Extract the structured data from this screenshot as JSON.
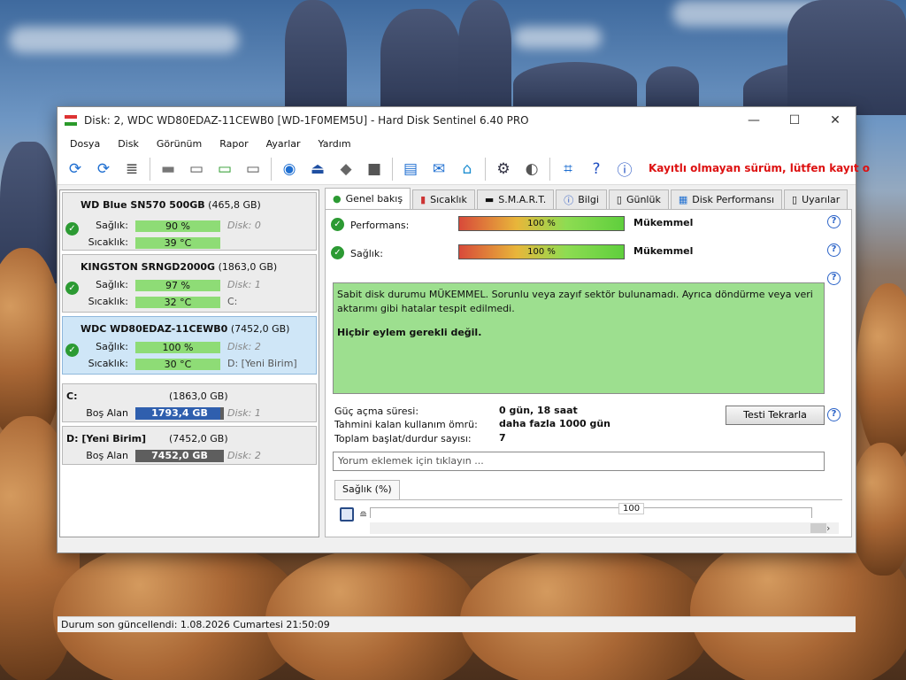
{
  "window": {
    "title": "Disk: 2, WDC WD80EDAZ-11CEWB0 [WD-1F0MEM5U]  -  Hard Disk Sentinel 6.40 PRO",
    "minimize": "—",
    "maximize": "☐",
    "close": "✕"
  },
  "menu": [
    "Dosya",
    "Disk",
    "Görünüm",
    "Rapor",
    "Ayarlar",
    "Yardım"
  ],
  "toolbar": {
    "unregistered_notice": "Kayıtlı olmayan sürüm, lütfen kayıt o"
  },
  "disks": [
    {
      "name": "WD Blue SN570 500GB",
      "size": "(465,8 GB)",
      "health_label": "Sağlık:",
      "health_value": "90 %",
      "temp_label": "Sıcaklık:",
      "temp_value": "39 °C",
      "disk_index": "Disk: 0",
      "partition": ""
    },
    {
      "name": "KINGSTON SRNGD2000G",
      "size": "(1863,0 GB)",
      "health_label": "Sağlık:",
      "health_value": "97 %",
      "temp_label": "Sıcaklık:",
      "temp_value": "32 °C",
      "disk_index": "Disk: 1",
      "partition": "C:"
    },
    {
      "name": "WDC WD80EDAZ-11CEWB0",
      "size": "(7452,0 GB)",
      "health_label": "Sağlık:",
      "health_value": "100 %",
      "temp_label": "Sıcaklık:",
      "temp_value": "30 °C",
      "disk_index": "Disk: 2",
      "partition": "D: [Yeni Birim]"
    }
  ],
  "volumes": [
    {
      "name": "C:",
      "size": "(1863,0 GB)",
      "free_label": "Boş Alan",
      "free_value": "1793,4 GB",
      "free_fraction": 0.96,
      "disk_index": "Disk: 1"
    },
    {
      "name": "D: [Yeni Birim]",
      "size": "(7452,0 GB)",
      "free_label": "Boş Alan",
      "free_value": "7452,0 GB",
      "free_fraction": 1.0,
      "disk_index": "Disk: 2"
    }
  ],
  "tabs": [
    "Genel bakış",
    "Sıcaklık",
    "S.M.A.R.T.",
    "Bilgi",
    "Günlük",
    "Disk Performansı",
    "Uyarılar"
  ],
  "overview": {
    "performance_label": "Performans:",
    "performance_value": "100 %",
    "performance_status": "Mükemmel",
    "health_label": "Sağlık:",
    "health_value": "100 %",
    "health_status": "Mükemmel",
    "description": "Sabit disk durumu MÜKEMMEL. Sorunlu veya zayıf sektör bulunamadı. Ayrıca döndürme veya veri aktarımı gibi hatalar tespit edilmedi.",
    "action": "Hiçbir eylem gerekli değil.",
    "power_on_label": "Güç açma süresi:",
    "power_on_value": "0 gün, 18 saat",
    "lifetime_label": "Tahmini kalan kullanım ömrü:",
    "lifetime_value": "daha fazla 1000 gün",
    "start_stop_label": "Toplam başlat/durdur sayısı:",
    "start_stop_value": "7",
    "retest_button": "Testi Tekrarla",
    "comment_placeholder": "Yorum eklemek için tıklayın ...",
    "chart_tab": "Sağlık (%)",
    "chart_value": "100"
  },
  "statusbar": {
    "text": "Durum son güncellendi: 1.08.2026 Cumartesi 21:50:09"
  },
  "colors": {
    "health_bar": "#8edc76",
    "selected_disk": "#cfe6f7",
    "status_box": "#9ddf8f",
    "unregistered": "#d11111"
  }
}
